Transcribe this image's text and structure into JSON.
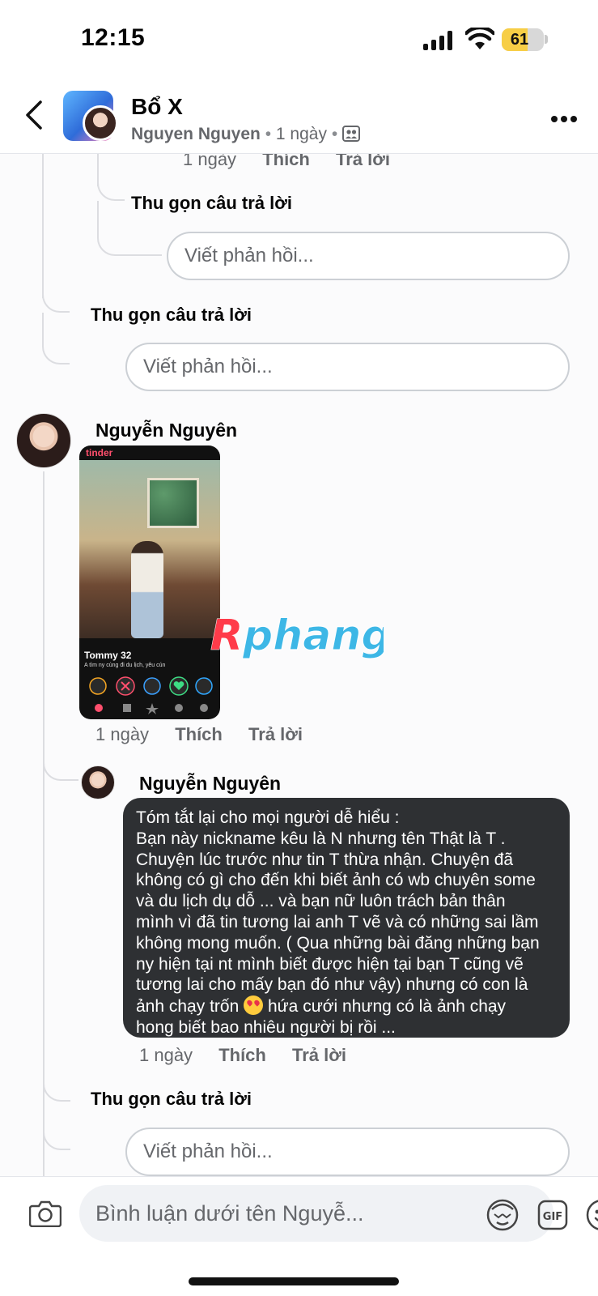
{
  "status_bar": {
    "time": "12:15",
    "battery": "61",
    "battery_level": 0.61
  },
  "header": {
    "title": "Bổ X",
    "author": "Nguyen Nguyen",
    "age": "1 ngày",
    "dot": "•"
  },
  "thread": {
    "top_meta": {
      "time": "1 ngày",
      "like": "Thích",
      "reply": "Trả lời"
    },
    "collapse_1": "Thu gọn câu trả lời",
    "reply_box_1": "Viết phản hồi...",
    "collapse_2": "Thu gọn câu trả lời",
    "reply_box_2": "Viết phản hồi...",
    "comment_1": {
      "author": "Nguyễn Nguyên",
      "meta": {
        "time": "1 ngày",
        "like": "Thích",
        "reply": "Trả lời"
      },
      "image": {
        "app_label": "tinder",
        "profile_name": "Tommy 32",
        "bio": "A tìm ny cùng đi du lịch, yêu cún"
      }
    },
    "watermark": "Rphang",
    "reply_1": {
      "author": "Nguyễn Nguyên",
      "text_before_emoji": "Tóm tắt lại cho mọi người dễ hiểu :\nBạn này nickname kêu là N nhưng tên Thật là T .\nChuyện lúc trước như tin T thừa nhận. Chuyện đã\nkhông có gì cho đến khi biết ảnh có wb chuyên some\nvà du lịch dụ dỗ ... và bạn nữ luôn trách bản thân\nmình vì đã tin tương lai anh T vẽ và có những sai lầm\nkhông mong muốn. ( Qua những bài đăng những bạn\nny hiện tại nt mình biết được hiện tại bạn T cũng vẽ\ntương lai cho mấy bạn đó như vậy) nhưng có con là\nảnh chạy trốn",
      "text_after_emoji": " hứa cưới nhưng có là ảnh chạy\nhong biết bao nhiêu người bị rồi ...",
      "emoji": "heart-eyes-emoji",
      "meta": {
        "time": "1 ngày",
        "like": "Thích",
        "reply": "Trả lời"
      }
    },
    "collapse_3": "Thu gọn câu trả lời",
    "reply_box_3": "Viết phản hồi..."
  },
  "composer": {
    "placeholder": "Bình luận dưới tên Nguyễ..."
  },
  "colors": {
    "bubble_bg": "#2e3033",
    "battery_fill": "#f7ce46",
    "muted_text": "#65676b"
  }
}
